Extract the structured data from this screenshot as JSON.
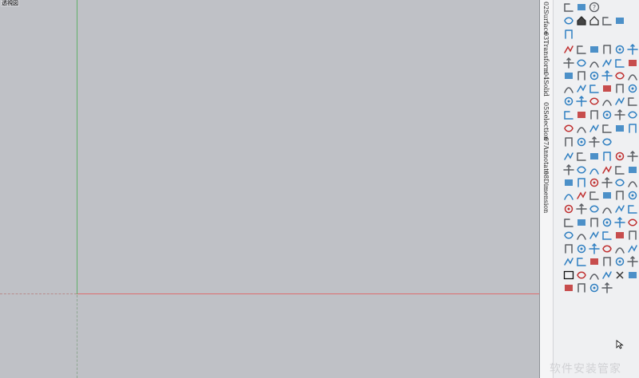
{
  "viewport": {
    "label": "透視図"
  },
  "panel": {
    "tabs": [
      "02Surface",
      "03Transform",
      "04Solid",
      "05Selection",
      "07Annotate",
      "08Dimension"
    ]
  },
  "watermark": "软件安装管家",
  "colors": {
    "viewport_bg": "#bfc1c6",
    "green_axis": "#62b06a",
    "red_axis": "#dd6e6e",
    "panel_bg": "#eff0f2",
    "icon_blue": "#2f7fc1",
    "icon_red": "#c03030",
    "icon_gray": "#5a5d63"
  },
  "icon_rows": [
    [
      "layers-icon",
      "layers-alt-icon",
      "help-icon"
    ],
    [
      "box-icon",
      "house-icon",
      "house-outline-icon",
      "store-icon",
      "store-alt-icon"
    ],
    [
      "store-cluster-icon"
    ],
    [
      "bracket-left-icon",
      "bracket-square-icon",
      "angle-icon",
      "bracket-right-icon",
      "bracket-open-icon",
      "caret-line-icon"
    ],
    [
      "orbit-icon",
      "eye-icon",
      "ellipse-icon",
      "move-icon",
      "move-cross-icon",
      "bolt-icon"
    ],
    [
      "arc-icon",
      "flat-arc-icon",
      "spiral-icon",
      "sweep-icon",
      "funnel-icon",
      "curve-icon"
    ],
    [
      "line-corner-icon",
      "corner-icon",
      "arch-icon",
      "arc-half-icon",
      "arc-quarter-icon",
      "wave-icon"
    ],
    [
      "bowl-icon",
      "grid-icon",
      "columns-icon",
      "columns-alt-icon",
      "hashtag-icon",
      "polygon-icon"
    ],
    [
      "rotate-icon",
      "branch-icon",
      "fence-icon",
      "dot-icon",
      "s-curve-icon",
      "slash-icon"
    ],
    [
      "runner-icon",
      "zigzag-icon",
      "target-icon",
      "lasso-icon",
      "link-icon",
      "ruler-icon"
    ],
    [
      "pin-icon",
      "stack-lines-icon",
      "axis-icon",
      "graph-icon"
    ],
    [
      "pencil-icon",
      "magnifier-icon",
      "line-tool-icon",
      "undo-icon",
      "redo-icon",
      "pointer-icon"
    ],
    [
      "brush-icon",
      "paint-icon",
      "pen-icon",
      "ribbon-icon",
      "frame-icon",
      "fill-icon"
    ],
    [
      "sphere-icon",
      "disc-icon",
      "shell-icon",
      "lens-icon",
      "ring-icon",
      "slab-icon"
    ],
    [
      "spark-icon",
      "diamond-icon",
      "cycle-icon",
      "square-red-icon",
      "panel-icon",
      "orb-icon"
    ],
    [
      "wrench-icon",
      "scissors-icon",
      "eraser-icon",
      "camera-icon",
      "star-icon",
      "cone-icon"
    ],
    [
      "magnet-icon",
      "leaf-icon",
      "probe-icon",
      "section-icon",
      "close-box-icon",
      "zoom-icon"
    ],
    [
      "pin-small-icon",
      "cup-icon",
      "key-icon",
      "crosshair-icon",
      "expand-icon",
      "compass-icon"
    ],
    [
      "cube-stack-icon",
      "cube-open-icon",
      "drawer-icon",
      "cube-blue-icon",
      "tile-icon",
      "clock-icon"
    ],
    [
      "tag-icon",
      "cube-gray-icon",
      "bar-stack-icon",
      "split-icon",
      "card-blue-icon",
      "pie-icon"
    ],
    [
      "rectangle-icon",
      "spring-icon",
      "printer-icon",
      "diagonal-icon",
      "x-mark-icon",
      "dice-icon"
    ],
    [
      "disk-icon",
      "clipboard-icon",
      "copy-icon",
      "refresh-icon"
    ]
  ]
}
